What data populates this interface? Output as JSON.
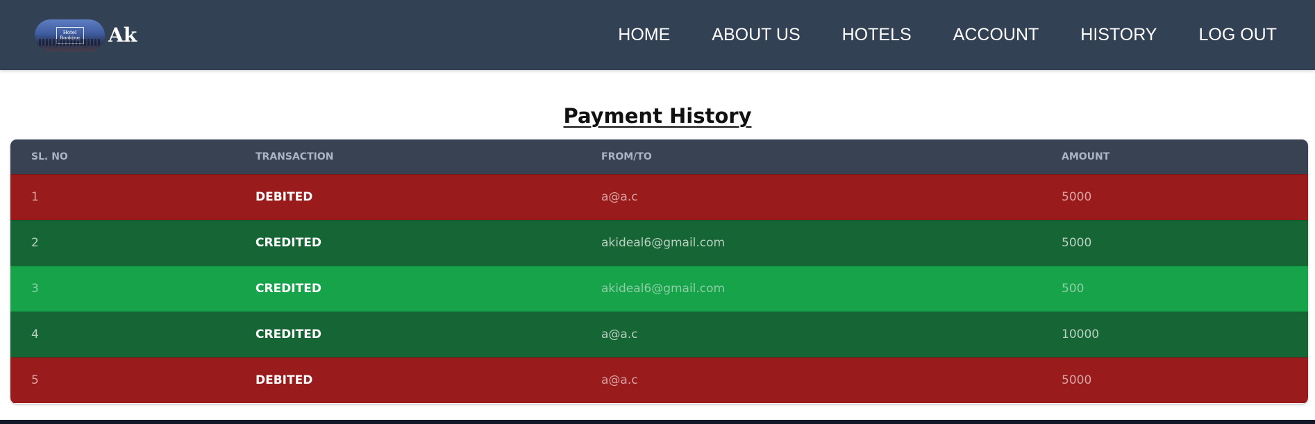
{
  "brand": {
    "name": "Ak",
    "logo_text_line1": "Hotel",
    "logo_text_line2": "Booking"
  },
  "nav": {
    "items": [
      {
        "label": "HOME"
      },
      {
        "label": "ABOUT US"
      },
      {
        "label": "HOTELS"
      },
      {
        "label": "ACCOUNT"
      },
      {
        "label": "HISTORY"
      },
      {
        "label": "LOG OUT"
      }
    ]
  },
  "page": {
    "title": "Payment History"
  },
  "table": {
    "headers": [
      "SL. NO",
      "TRANSACTION",
      "FROM/TO",
      "AMOUNT"
    ],
    "rows": [
      {
        "sl": "1",
        "transaction": "DEBITED",
        "from_to": "a@a.c",
        "amount": "5000",
        "style": "debited"
      },
      {
        "sl": "2",
        "transaction": "CREDITED",
        "from_to": "akideal6@gmail.com",
        "amount": "5000",
        "style": "credited-dark"
      },
      {
        "sl": "3",
        "transaction": "CREDITED",
        "from_to": "akideal6@gmail.com",
        "amount": "500",
        "style": "credited-light"
      },
      {
        "sl": "4",
        "transaction": "CREDITED",
        "from_to": "a@a.c",
        "amount": "10000",
        "style": "credited-dark"
      },
      {
        "sl": "5",
        "transaction": "DEBITED",
        "from_to": "a@a.c",
        "amount": "5000",
        "style": "debited"
      }
    ]
  },
  "colors": {
    "navbar": "#334155",
    "table_header": "#384253",
    "debited": "#991b1b",
    "credited_dark": "#166534",
    "credited_light": "#16a34a"
  }
}
